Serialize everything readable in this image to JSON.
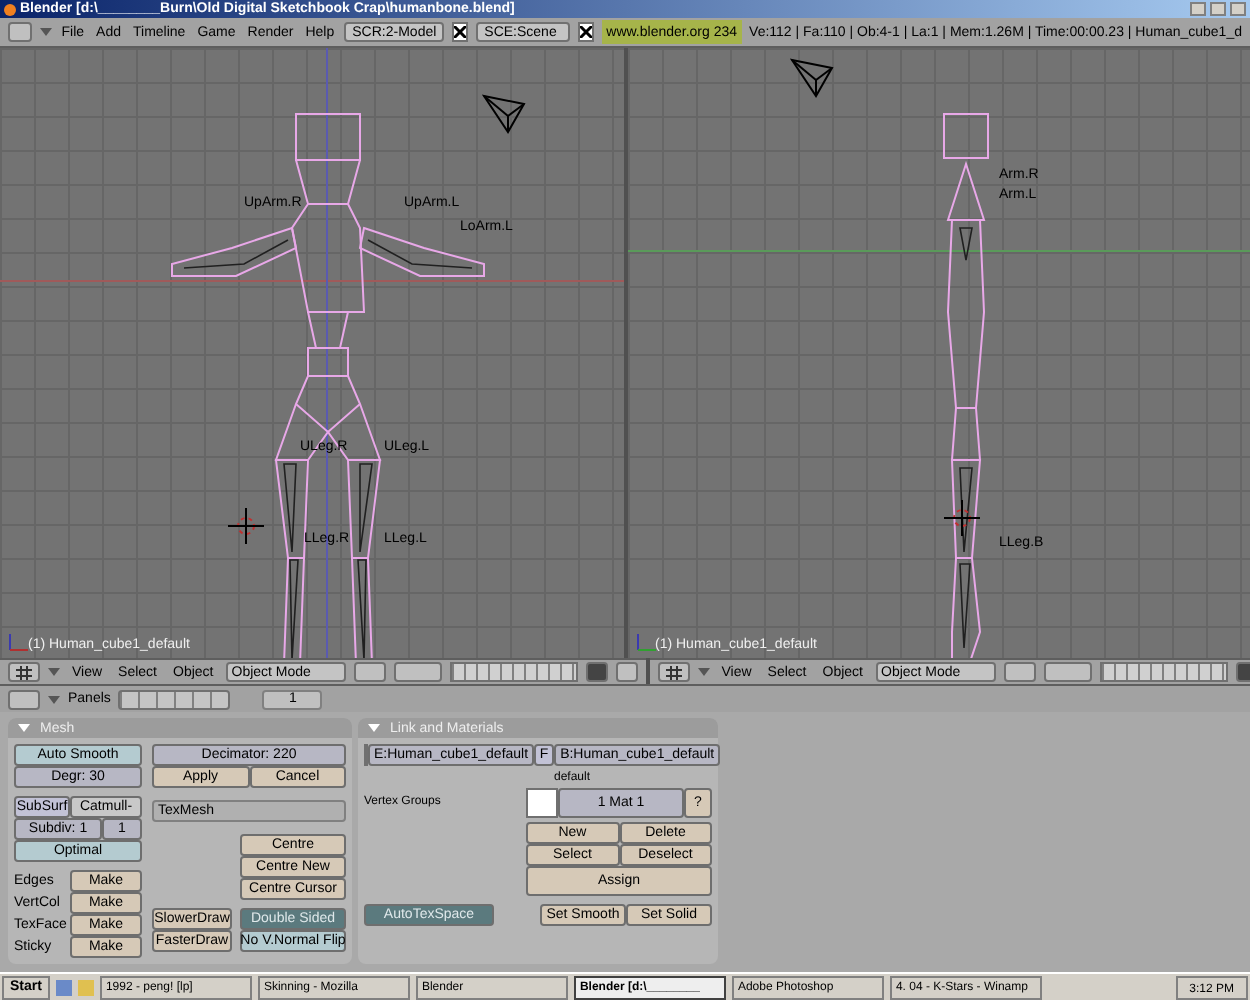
{
  "title_bar": {
    "title": "Blender [d:\\________Burn\\Old Digital Sketchbook Crap\\humanbone.blend]"
  },
  "menu_bar": {
    "menus": [
      "File",
      "Add",
      "Timeline",
      "Game",
      "Render",
      "Help"
    ],
    "screen": "SCR:2-Model",
    "scene": "SCE:Scene",
    "site": "www.blender.org 234",
    "stats": "Ve:112 | Fa:110 | Ob:4-1 | La:1 | Mem:1.26M | Time:00:00.23 | Human_cube1_d"
  },
  "viewports": [
    {
      "kind": "front",
      "label": "(1) Human_cube1_default",
      "bone_labels": [
        "UpArm.R",
        "UpArm.L",
        "LoArm.L",
        "ULeg.R",
        "ULeg.L",
        "LLeg.R",
        "LLeg.L"
      ]
    },
    {
      "kind": "side",
      "label": "(1) Human_cube1_default",
      "bone_labels": [
        "Arm.R",
        "Arm.L",
        "LLeg.B"
      ]
    }
  ],
  "viewport_headers": [
    {
      "menus": [
        "View",
        "Select",
        "Object"
      ],
      "mode": "Object Mode"
    },
    {
      "menus": [
        "View",
        "Select",
        "Object"
      ],
      "mode": "Object Mode"
    }
  ],
  "buttons_header": {
    "menu": "Panels",
    "frame": "1"
  },
  "mesh_panel": {
    "title": "Mesh",
    "auto_smooth": {
      "label": "Auto Smooth",
      "on": false
    },
    "degr": "Degr: 30",
    "decimator": "Decimator: 220",
    "apply": "Apply",
    "cancel": "Cancel",
    "subsurf": "SubSurf",
    "subsurf_type": "Catmull-",
    "subdiv": "Subdiv: 1",
    "subdiv_render": "1",
    "optimal": {
      "label": "Optimal",
      "on": false
    },
    "texmesh": "TexMesh",
    "centre": [
      "Centre",
      "Centre New",
      "Centre Cursor"
    ],
    "makes": [
      {
        "label": "Edges",
        "button": "Make"
      },
      {
        "label": "VertCol",
        "button": "Make"
      },
      {
        "label": "TexFace",
        "button": "Make"
      },
      {
        "label": "Sticky",
        "button": "Make"
      }
    ],
    "draw": [
      "SlowerDraw",
      "FasterDraw"
    ],
    "double_sided": {
      "label": "Double Sided",
      "on": true
    },
    "no_vnormal_flip": {
      "label": "No V.Normal Flip",
      "on": false
    }
  },
  "link_panel": {
    "title": "Link and Materials",
    "mesh_name": "E:Human_cube1_default",
    "f": "F",
    "object_name": "B:Human_cube1_default",
    "vertex_groups": "Vertex Groups",
    "group_name": "default",
    "material": "1 Mat 1",
    "help": "?",
    "buttons": [
      "New",
      "Delete",
      "Select",
      "Deselect",
      "Assign"
    ],
    "auto_tex_space": {
      "label": "AutoTexSpace",
      "on": true
    },
    "set_smooth": "Set Smooth",
    "set_solid": "Set Solid"
  },
  "taskbar": {
    "start": "Start",
    "tasks": [
      {
        "label": "1992 - peng! [lp]",
        "selected": false
      },
      {
        "label": "Skinning - Mozilla",
        "selected": false
      },
      {
        "label": "Blender",
        "selected": false
      },
      {
        "label": "Blender [d:\\________",
        "selected": true
      },
      {
        "label": "Adobe Photoshop",
        "selected": false
      },
      {
        "label": "4. 04 - K-Stars - Winamp",
        "selected": false
      }
    ],
    "time": "3:12 PM"
  }
}
